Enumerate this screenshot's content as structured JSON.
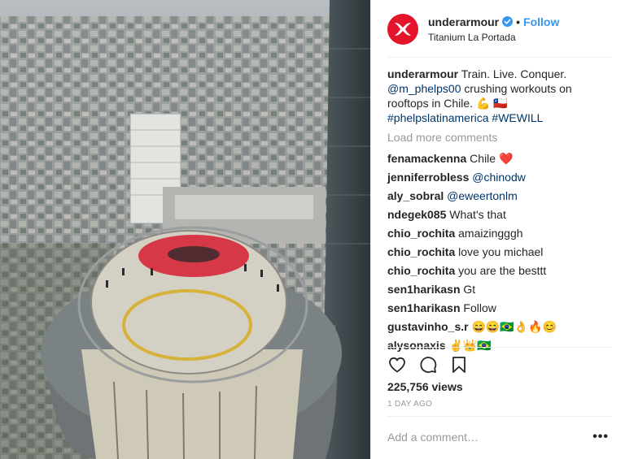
{
  "header": {
    "username": "underarmour",
    "separator": "•",
    "follow_label": "Follow",
    "location": "Titanium La Portada",
    "avatar_icon": "under-armour-logo-icon",
    "verified_icon": "verified-badge-icon"
  },
  "caption": {
    "username": "underarmour",
    "text1": "Train. Live. Conquer.",
    "mention": "@m_phelps00",
    "text2": "crushing workouts on rooftops in Chile.",
    "emoji": "💪 🇨🇱",
    "hashtag1": "#phelpslatinamerica",
    "hashtag2": "#WEWILL"
  },
  "load_more_label": "Load more comments",
  "comments": [
    {
      "user": "fenamackenna",
      "text": "Chile ❤️"
    },
    {
      "user": "jenniferrobless",
      "text": "@chinodw"
    },
    {
      "user": "aly_sobral",
      "text": "@eweertonlm"
    },
    {
      "user": "ndegek085",
      "text": "What's that"
    },
    {
      "user": "chio_rochita",
      "text": "amaizingggh"
    },
    {
      "user": "chio_rochita",
      "text": "love you michael"
    },
    {
      "user": "chio_rochita",
      "text": "you are the besttt"
    },
    {
      "user": "sen1harikasn",
      "text": "Gt"
    },
    {
      "user": "sen1harikasn",
      "text": "Follow"
    },
    {
      "user": "gustavinho_s.r",
      "text": "😄😄🇧🇷👌🔥😊"
    },
    {
      "user": "alysonaxis",
      "text": "✌️👑🇧🇷"
    }
  ],
  "actions": {
    "like_icon": "heart-icon",
    "comment_icon": "comment-icon",
    "save_icon": "bookmark-icon"
  },
  "views": "225,756 views",
  "age": "1 DAY AGO",
  "add_comment_placeholder": "Add a comment…",
  "more_label": "•••",
  "colors": {
    "follow": "#3897f0",
    "link": "#003569",
    "brand": "#e3142b",
    "muted": "#999999"
  }
}
